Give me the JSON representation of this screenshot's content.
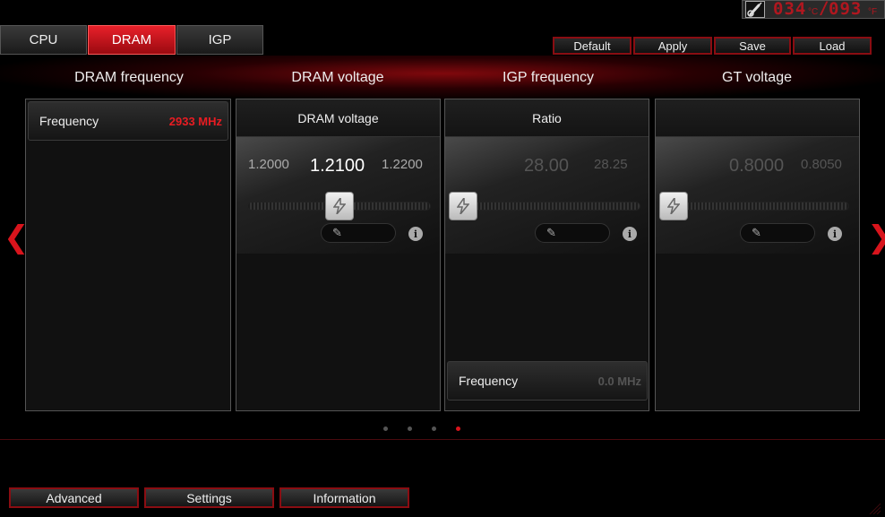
{
  "top": {
    "temp_cpu": "034",
    "unit_c": "°C",
    "temp_f": "093",
    "unit_f": "°F"
  },
  "tabs": [
    {
      "label": "CPU",
      "active": false
    },
    {
      "label": "DRAM",
      "active": true
    },
    {
      "label": "IGP",
      "active": false
    }
  ],
  "actions": {
    "default": "Default",
    "apply": "Apply",
    "save": "Save",
    "load": "Load"
  },
  "sections": {
    "dram_frequency": "DRAM frequency",
    "dram_voltage": "DRAM voltage",
    "igp_frequency": "IGP frequency",
    "gt_voltage": "GT voltage"
  },
  "dram_freq_panel": {
    "label": "Frequency",
    "value": "2933 MHz"
  },
  "dram_voltage_panel": {
    "title": "DRAM voltage",
    "prev": "1.2000",
    "current": "1.2100",
    "next": "1.2200",
    "slider_level_fraction": 0.5
  },
  "igp_panel": {
    "title": "Ratio",
    "current": "28.00",
    "next": "28.25",
    "freq_label": "Frequency",
    "freq_value": "0.0 MHz",
    "slider_level_fraction": 0.0
  },
  "gt_panel": {
    "title": "",
    "current": "0.8000",
    "next": "0.8050",
    "slider_level_fraction": 0.0
  },
  "pager": {
    "count": 4,
    "active_index": 3
  },
  "bottom": {
    "advanced": "Advanced",
    "settings": "Settings",
    "information": "Information"
  },
  "icons": {
    "slider_knob": "lightning-icon",
    "edit": "pencil-icon",
    "info": "info-icon",
    "nav_prev": "chevron-left-icon",
    "nav_next": "chevron-right-icon",
    "temperature": "thermometer-icon"
  },
  "colors": {
    "accent": "#d8141c",
    "led": "#b0171f"
  }
}
